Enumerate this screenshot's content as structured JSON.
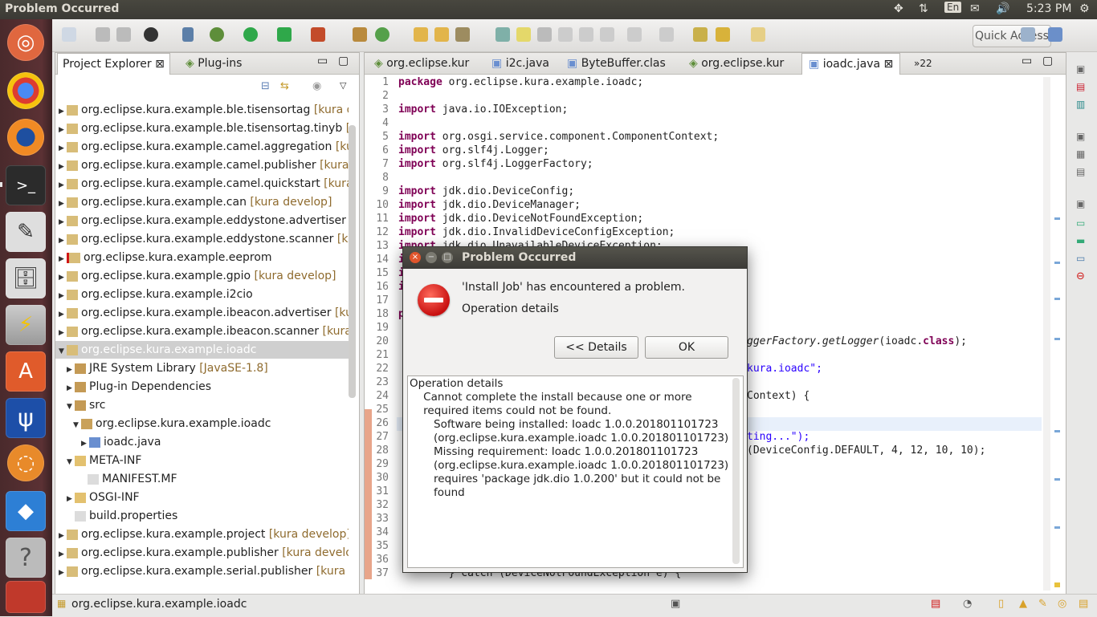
{
  "window": {
    "title": "Problem Occurred"
  },
  "topbar": {
    "keyboard": "En",
    "time": "5:23 PM"
  },
  "toolbar": {
    "quick_access": "Quick Access"
  },
  "left_panel": {
    "tabs": [
      "Project Explorer",
      "Plug-ins"
    ],
    "tree": [
      {
        "label": "org.eclipse.kura.example.ble.tisensortag",
        "deco": "[kura de"
      },
      {
        "label": "org.eclipse.kura.example.ble.tisensortag.tinyb",
        "deco": "[k"
      },
      {
        "label": "org.eclipse.kura.example.camel.aggregation",
        "deco": "[kura"
      },
      {
        "label": "org.eclipse.kura.example.camel.publisher",
        "deco": "[kura d"
      },
      {
        "label": "org.eclipse.kura.example.camel.quickstart",
        "deco": "[kura d"
      },
      {
        "label": "org.eclipse.kura.example.can",
        "deco": "[kura develop]"
      },
      {
        "label": "org.eclipse.kura.example.eddystone.advertiser",
        "deco": "[k"
      },
      {
        "label": "org.eclipse.kura.example.eddystone.scanner",
        "deco": "[kur"
      },
      {
        "label": "org.eclipse.kura.example.eeprom",
        "deco": ""
      },
      {
        "label": "org.eclipse.kura.example.gpio",
        "deco": "[kura develop]"
      },
      {
        "label": "org.eclipse.kura.example.i2cio",
        "deco": ""
      },
      {
        "label": "org.eclipse.kura.example.ibeacon.advertiser",
        "deco": "[kura"
      },
      {
        "label": "org.eclipse.kura.example.ibeacon.scanner",
        "deco": "[kura de"
      },
      {
        "label": "org.eclipse.kura.example.ioadc",
        "deco": ""
      },
      {
        "label": "JRE System Library",
        "deco": "[JavaSE-1.8]"
      },
      {
        "label": "Plug-in Dependencies",
        "deco": ""
      },
      {
        "label": "src",
        "deco": ""
      },
      {
        "label": "org.eclipse.kura.example.ioadc",
        "deco": ""
      },
      {
        "label": "ioadc.java",
        "deco": ""
      },
      {
        "label": "META-INF",
        "deco": ""
      },
      {
        "label": "MANIFEST.MF",
        "deco": ""
      },
      {
        "label": "OSGI-INF",
        "deco": ""
      },
      {
        "label": "build.properties",
        "deco": ""
      },
      {
        "label": "org.eclipse.kura.example.project",
        "deco": "[kura develop]"
      },
      {
        "label": "org.eclipse.kura.example.publisher",
        "deco": "[kura develop"
      },
      {
        "label": "org.eclipse.kura.example.serial.publisher",
        "deco": "[kura de"
      }
    ]
  },
  "editor": {
    "tabs": [
      "org.eclipse.kur",
      "i2c.java",
      "ByteBuffer.clas",
      "org.eclipse.kur",
      "ioadc.java",
      "»22"
    ],
    "lines": [
      {
        "n": "1",
        "t": "package org.eclipse.kura.example.ioadc;"
      },
      {
        "n": "2",
        "t": ""
      },
      {
        "n": "3",
        "t": "import java.io.IOException;"
      },
      {
        "n": "4",
        "t": ""
      },
      {
        "n": "5",
        "t": "import org.osgi.service.component.ComponentContext;"
      },
      {
        "n": "6",
        "t": "import org.slf4j.Logger;"
      },
      {
        "n": "7",
        "t": "import org.slf4j.LoggerFactory;"
      },
      {
        "n": "8",
        "t": ""
      },
      {
        "n": "9",
        "t": "import jdk.dio.DeviceConfig;"
      },
      {
        "n": "10",
        "t": "import jdk.dio.DeviceManager;"
      },
      {
        "n": "11",
        "t": "import jdk.dio.DeviceNotFoundException;"
      },
      {
        "n": "12",
        "t": "import jdk.dio.InvalidDeviceConfigException;"
      },
      {
        "n": "13",
        "t": "import jdk.dio.UnavailableDeviceException;"
      },
      {
        "n": "14",
        "t": "i"
      },
      {
        "n": "15",
        "t": "i"
      },
      {
        "n": "16",
        "t": "i"
      },
      {
        "n": "17",
        "t": ""
      },
      {
        "n": "18",
        "t": "p"
      },
      {
        "n": "19",
        "t": ""
      },
      {
        "n": "20",
        "t": ""
      },
      {
        "n": "21",
        "t": ""
      },
      {
        "n": "22",
        "t": ""
      },
      {
        "n": "23",
        "t": ""
      },
      {
        "n": "24",
        "t": ""
      },
      {
        "n": "25",
        "t": ""
      },
      {
        "n": "26",
        "t": ""
      },
      {
        "n": "27",
        "t": ""
      },
      {
        "n": "28",
        "t": ""
      },
      {
        "n": "29",
        "t": ""
      },
      {
        "n": "30",
        "t": ""
      },
      {
        "n": "31",
        "t": ""
      },
      {
        "n": "32",
        "t": ""
      },
      {
        "n": "33",
        "t": ""
      },
      {
        "n": "34",
        "t": ""
      },
      {
        "n": "35",
        "t": ""
      },
      {
        "n": "36",
        "t": ""
      },
      {
        "n": "37",
        "t": "        } catch (DeviceNotFoundException e) {"
      }
    ],
    "frag20": "ggerFactory.getLogger(ioadc.class);",
    "frag22": "kura.ioadc\";",
    "frag24": "Context) {",
    "frag27": "ting...\");",
    "frag28": "(DeviceConfig.DEFAULT, 4, 12, 10, 10);"
  },
  "dialog": {
    "title": "Problem Occurred",
    "message": "'Install Job' has encountered a problem.",
    "sub": "Operation details",
    "details_button": "<< Details",
    "ok_button": "OK",
    "details_text": "Operation details\n    Cannot complete the install because one or more\n    required items could not be found.\n       Software being installed: Ioadc 1.0.0.201801101723\n       (org.eclipse.kura.example.ioadc 1.0.0.201801101723)\n       Missing requirement: Ioadc 1.0.0.201801101723\n       (org.eclipse.kura.example.ioadc 1.0.0.201801101723)\n       requires 'package jdk.dio 1.0.200' but it could not be\n       found"
  },
  "status": {
    "selection": "org.eclipse.kura.example.ioadc"
  },
  "colors": {
    "accent": "#dd4814",
    "error": "#d01616",
    "keyword": "#7f0055"
  }
}
